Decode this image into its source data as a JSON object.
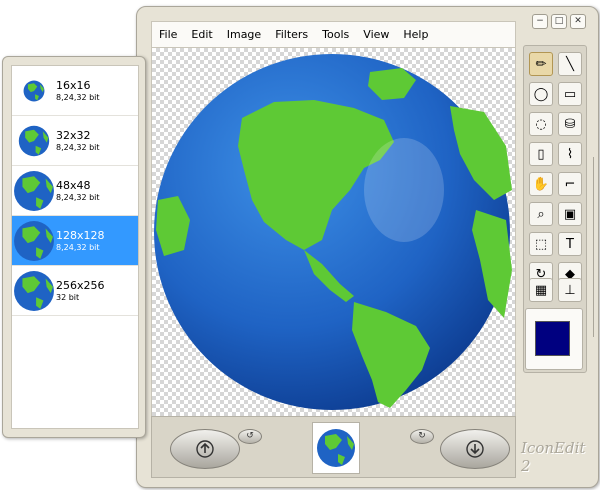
{
  "menu": [
    "File",
    "Edit",
    "Image",
    "Filters",
    "Tools",
    "View",
    "Help"
  ],
  "window_controls": [
    "−",
    "□",
    "✕"
  ],
  "sizes": [
    {
      "label": "16x16",
      "depth": "8,24,32 bit",
      "selected": false
    },
    {
      "label": "32x32",
      "depth": "8,24,32 bit",
      "selected": false
    },
    {
      "label": "48x48",
      "depth": "8,24,32 bit",
      "selected": false
    },
    {
      "label": "128x128",
      "depth": "8,24,32 bit",
      "selected": true
    },
    {
      "label": "256x256",
      "depth": "32 bit",
      "selected": false
    }
  ],
  "tools": [
    {
      "name": "pencil-tool-icon",
      "glyph": "✏"
    },
    {
      "name": "line-tool-icon",
      "glyph": "╲"
    },
    {
      "name": "ellipse-tool-icon",
      "glyph": "◯"
    },
    {
      "name": "rounded-rect-tool-icon",
      "glyph": "▭"
    },
    {
      "name": "lasso-tool-icon",
      "glyph": "◌"
    },
    {
      "name": "fill-bucket-tool-icon",
      "glyph": "⛁"
    },
    {
      "name": "spray-tool-icon",
      "glyph": "▯"
    },
    {
      "name": "eyedropper-tool-icon",
      "glyph": "⌇"
    },
    {
      "name": "hand-tool-icon",
      "glyph": "✋"
    },
    {
      "name": "brush-tool-icon",
      "glyph": "⌐"
    },
    {
      "name": "zoom-tool-icon",
      "glyph": "⌕"
    },
    {
      "name": "image-tool-icon",
      "glyph": "▣"
    },
    {
      "name": "selection-tool-icon",
      "glyph": "⬚"
    },
    {
      "name": "text-tool-icon",
      "glyph": "T"
    },
    {
      "name": "rotate-tool-icon",
      "glyph": "↻"
    },
    {
      "name": "eraser-tool-icon",
      "glyph": "◆"
    },
    {
      "name": "grid-tool-icon",
      "glyph": "▦"
    },
    {
      "name": "ruler-tool-icon",
      "glyph": "⊥"
    },
    {
      "name": "zoom-in-tool-icon",
      "glyph": "⊕"
    },
    {
      "name": "zoom-out-tool-icon",
      "glyph": "⊖"
    }
  ],
  "active_tool": "pencil-tool-icon",
  "current_color": "#000080",
  "bottom": {
    "undo_glyph": "↺",
    "redo_glyph": "↻"
  },
  "logo": "IconEdit 2",
  "colors": {
    "ocean": "#1f63c4",
    "land": "#5ec935",
    "selection": "#3399ff"
  }
}
